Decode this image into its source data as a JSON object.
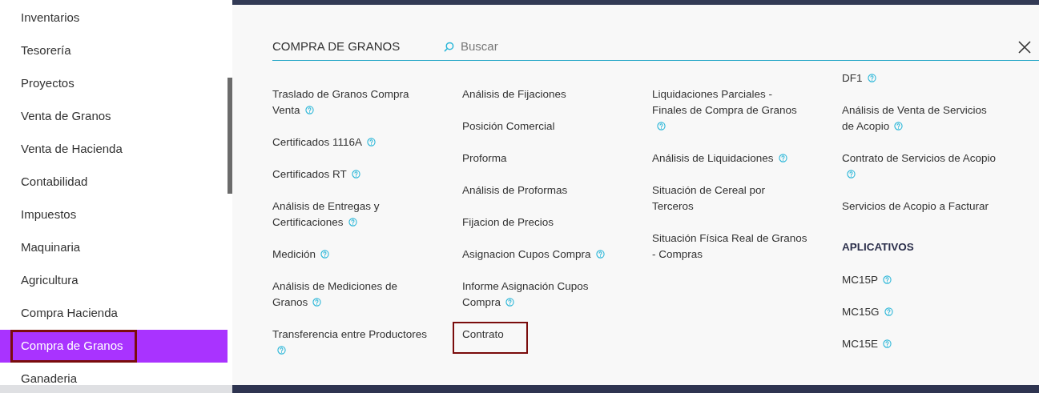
{
  "sidebar": {
    "items": [
      {
        "label": "Inventarios",
        "selected": false,
        "highlighted": false
      },
      {
        "label": "Tesorería",
        "selected": false,
        "highlighted": false
      },
      {
        "label": "Proyectos",
        "selected": false,
        "highlighted": false
      },
      {
        "label": "Venta de Granos",
        "selected": false,
        "highlighted": false
      },
      {
        "label": "Venta de Hacienda",
        "selected": false,
        "highlighted": false
      },
      {
        "label": "Contabilidad",
        "selected": false,
        "highlighted": false
      },
      {
        "label": "Impuestos",
        "selected": false,
        "highlighted": false
      },
      {
        "label": "Maquinaria",
        "selected": false,
        "highlighted": false
      },
      {
        "label": "Agricultura",
        "selected": false,
        "highlighted": false
      },
      {
        "label": "Compra Hacienda",
        "selected": false,
        "highlighted": false
      },
      {
        "label": "Compra de Granos",
        "selected": true,
        "highlighted": true
      },
      {
        "label": "Ganaderia",
        "selected": false,
        "highlighted": false
      }
    ]
  },
  "panel": {
    "title": "COMPRA DE GRANOS",
    "search": {
      "placeholder": "Buscar"
    },
    "columns": [
      {
        "entries": [
          {
            "kind": "link",
            "label": "Traslado de Granos Compra Venta",
            "help": true,
            "highlighted": false
          },
          {
            "kind": "link",
            "label": "Certificados 1116A",
            "help": true,
            "highlighted": false
          },
          {
            "kind": "link",
            "label": "Certificados RT",
            "help": true,
            "highlighted": false
          },
          {
            "kind": "link",
            "label": "Análisis de Entregas y Certificaciones",
            "help": true,
            "highlighted": false
          },
          {
            "kind": "link",
            "label": "Medición",
            "help": true,
            "highlighted": false
          },
          {
            "kind": "link",
            "label": "Análisis de Mediciones de Granos",
            "help": true,
            "highlighted": false
          },
          {
            "kind": "link",
            "label": "Transferencia entre Productores",
            "help": true,
            "highlighted": false
          }
        ]
      },
      {
        "entries": [
          {
            "kind": "link",
            "label": "Análisis de Fijaciones",
            "help": false,
            "highlighted": false
          },
          {
            "kind": "link",
            "label": "Posición Comercial",
            "help": false,
            "highlighted": false
          },
          {
            "kind": "link",
            "label": "Proforma",
            "help": false,
            "highlighted": false
          },
          {
            "kind": "link",
            "label": "Análisis de Proformas",
            "help": false,
            "highlighted": false
          },
          {
            "kind": "link",
            "label": "Fijacion de Precios",
            "help": false,
            "highlighted": false
          },
          {
            "kind": "link",
            "label": "Asignacion Cupos Compra",
            "help": true,
            "highlighted": false
          },
          {
            "kind": "link",
            "label": "Informe Asignación Cupos Compra",
            "help": true,
            "highlighted": false
          },
          {
            "kind": "link",
            "label": "Contrato",
            "help": false,
            "highlighted": true
          }
        ]
      },
      {
        "entries": [
          {
            "kind": "link",
            "label": "Liquidaciones Parciales - Finales de Compra de Granos",
            "help": true,
            "highlighted": false
          },
          {
            "kind": "link",
            "label": "Análisis de Liquidaciones",
            "help": true,
            "highlighted": false
          },
          {
            "kind": "link",
            "label": "Situación de Cereal por Terceros",
            "help": false,
            "highlighted": false
          },
          {
            "kind": "link",
            "label": "Situación Física Real de Granos - Compras",
            "help": false,
            "highlighted": false
          }
        ]
      },
      {
        "entries": [
          {
            "kind": "link",
            "label": "DF1",
            "help": true,
            "highlighted": false
          },
          {
            "kind": "link",
            "label": "Análisis de Venta de Servicios de Acopio",
            "help": true,
            "highlighted": false
          },
          {
            "kind": "link",
            "label": "Contrato de Servicios de Acopio",
            "help": true,
            "highlighted": false
          },
          {
            "kind": "link",
            "label": "Servicios de Acopio a Facturar",
            "help": false,
            "highlighted": false
          },
          {
            "kind": "heading",
            "label": "APLICATIVOS"
          },
          {
            "kind": "link",
            "label": "MC15P",
            "help": true,
            "highlighted": false
          },
          {
            "kind": "link",
            "label": "MC15G",
            "help": true,
            "highlighted": false
          },
          {
            "kind": "link",
            "label": "MC15E",
            "help": true,
            "highlighted": false
          }
        ]
      }
    ]
  }
}
